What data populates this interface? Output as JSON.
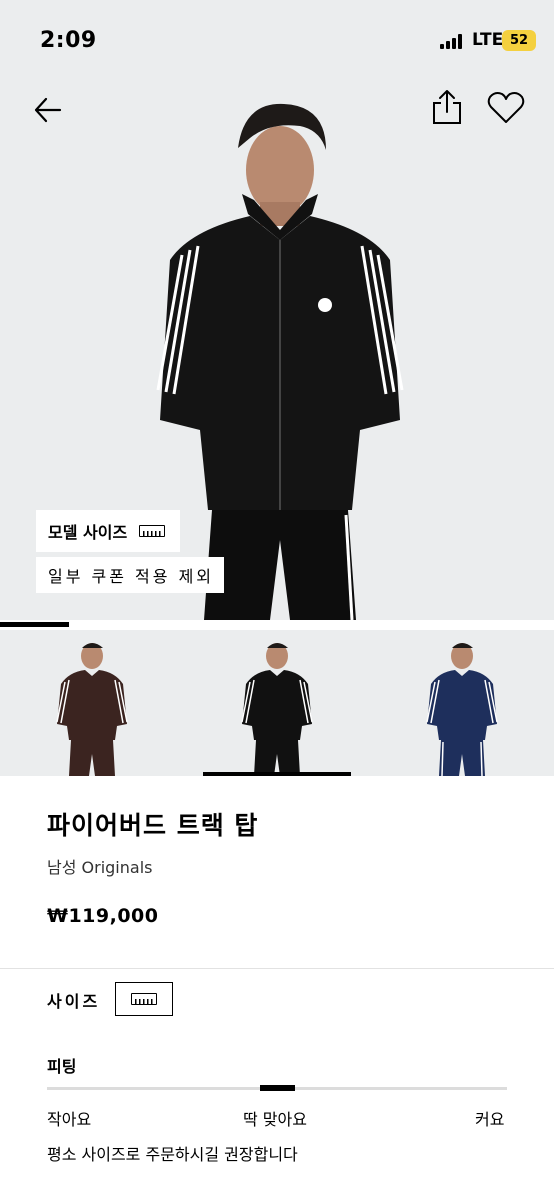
{
  "status_bar": {
    "time": "2:09",
    "network": "LTE",
    "battery": "52"
  },
  "hero": {
    "model_size_label": "모델 사이즈",
    "coupon_notice": "일부 쿠폰 적용 제외",
    "icons": [
      "back-arrow-icon",
      "share-icon",
      "heart-icon",
      "ruler-icon"
    ]
  },
  "gallery_progress": 0.125,
  "color_variants": [
    {
      "color_name": "brown",
      "color": "#3b2420",
      "selected": false
    },
    {
      "color_name": "black",
      "color": "#111111",
      "selected": true
    },
    {
      "color_name": "navy",
      "color": "#1e2f5c",
      "selected": false
    }
  ],
  "product": {
    "title": "파이어버드 트랙 탑",
    "subtitle": "남성 Originals",
    "price": "₩119,000"
  },
  "size": {
    "label": "사이즈"
  },
  "fit": {
    "label": "피팅",
    "scale_small": "작아요",
    "scale_mid": "딱 맞아요",
    "scale_large": "커요",
    "position": 0.5,
    "recommendation": "평소 사이즈로 주문하시길 권장합니다"
  },
  "colors": {
    "hero_bg": "#ebedee",
    "accent": "#000000",
    "battery": "#f4d03f"
  }
}
